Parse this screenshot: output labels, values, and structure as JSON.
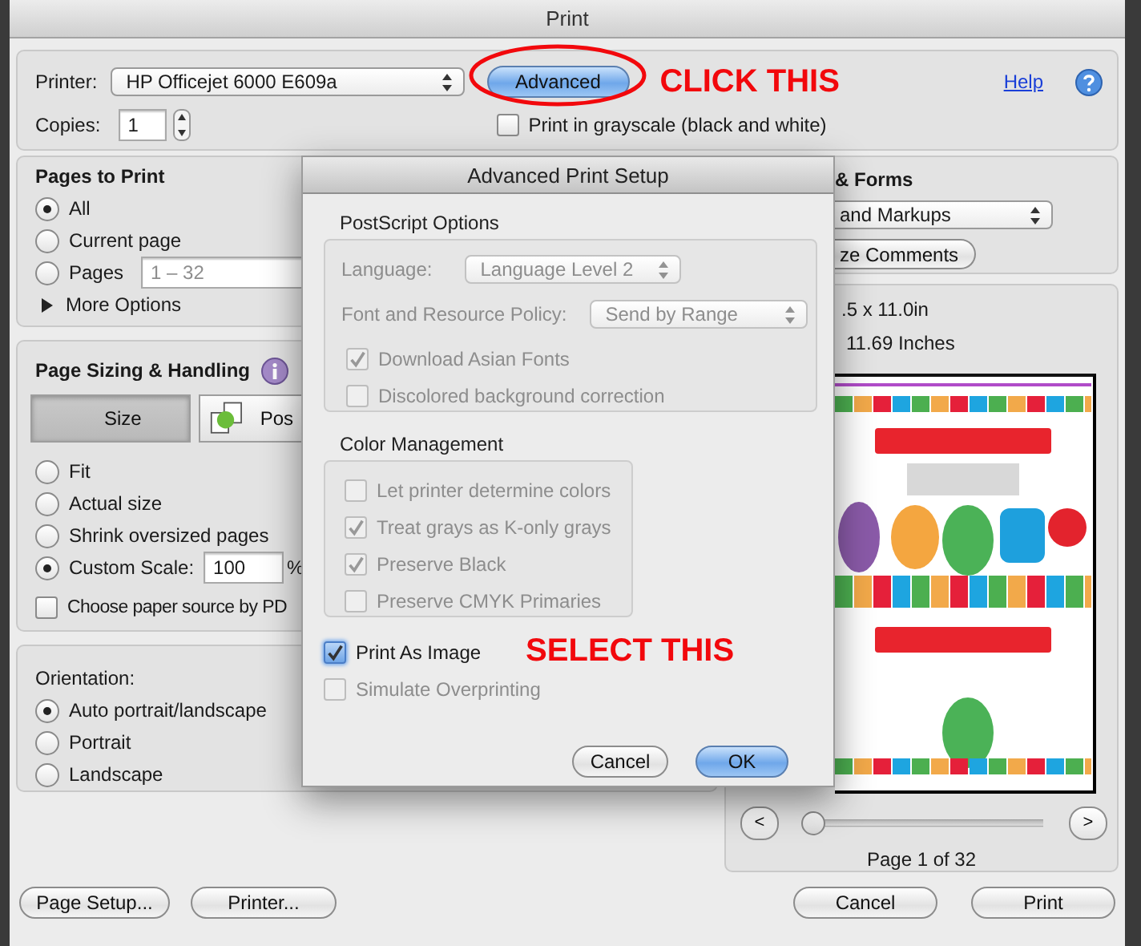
{
  "window": {
    "title": "Print"
  },
  "printer": {
    "label": "Printer:",
    "value": "HP Officejet 6000 E609a"
  },
  "advanced_button": {
    "label": "Advanced"
  },
  "click_note": "CLICK THIS",
  "help_link": "Help",
  "copies": {
    "label": "Copies:",
    "value": "1"
  },
  "grayscale": {
    "label": "Print in grayscale (black and white)",
    "checked": false
  },
  "pages_to_print": {
    "title": "Pages to Print",
    "options": [
      {
        "label": "All",
        "selected": true
      },
      {
        "label": "Current page",
        "selected": false
      },
      {
        "label": "Pages",
        "selected": false
      }
    ],
    "range": {
      "value": "1 – 32",
      "disabled": true
    },
    "more_options": {
      "label": "More Options",
      "expanded": false
    }
  },
  "page_sizing": {
    "title": "Page Sizing & Handling",
    "tabs": [
      {
        "label": "Size",
        "selected": true
      },
      {
        "label": "Pos",
        "selected": false
      }
    ],
    "options": [
      {
        "label": "Fit",
        "selected": false
      },
      {
        "label": "Actual size",
        "selected": false
      },
      {
        "label": "Shrink oversized pages",
        "selected": false
      },
      {
        "label": "Custom Scale:",
        "selected": true
      }
    ],
    "scale": {
      "value": "100",
      "unit": "%"
    },
    "paper_source": {
      "label": "Choose paper source by PD",
      "checked": false
    }
  },
  "orientation": {
    "title": "Orientation:",
    "options": [
      {
        "label": "Auto portrait/landscape",
        "selected": true
      },
      {
        "label": "Portrait",
        "selected": false
      },
      {
        "label": "Landscape",
        "selected": false
      }
    ]
  },
  "comments_forms": {
    "title": "& Forms",
    "dropdown": "and Markups",
    "button": "ze Comments"
  },
  "preview": {
    "paper_size": ".5 x 11.0in",
    "document_size": "11.69 Inches",
    "slider": {
      "level": 0
    },
    "prev": "<",
    "next": ">",
    "page_label": "Page 1 of 32"
  },
  "bottom_buttons_left": [
    "Page Setup...",
    "Printer..."
  ],
  "bottom_buttons_right": [
    "Cancel",
    "Print"
  ],
  "advanced": {
    "title": "Advanced Print Setup",
    "postscript": {
      "title": "PostScript Options",
      "language": {
        "label": "Language:",
        "value": "Language Level 2"
      },
      "policy": {
        "label": "Font and Resource Policy:",
        "value": "Send by Range"
      },
      "checks": [
        {
          "label": "Download Asian Fonts",
          "checked": true,
          "disabled": true
        },
        {
          "label": "Discolored background correction",
          "checked": false,
          "disabled": true
        }
      ]
    },
    "color_management": {
      "title": "Color Management",
      "checks": [
        {
          "label": "Let printer determine colors",
          "checked": false,
          "disabled": true
        },
        {
          "label": "Treat grays as K-only grays",
          "checked": true,
          "disabled": true
        },
        {
          "label": "Preserve Black",
          "checked": true,
          "disabled": true
        },
        {
          "label": "Preserve CMYK Primaries",
          "checked": false,
          "disabled": true
        }
      ]
    },
    "checks": [
      {
        "label": "Print As Image",
        "checked": true,
        "disabled": false
      },
      {
        "label": "Simulate Overprinting",
        "checked": false,
        "disabled": true
      }
    ],
    "select_note": "SELECT THIS",
    "buttons": [
      {
        "label": "Cancel",
        "default": false
      },
      {
        "label": "OK",
        "default": true
      }
    ]
  }
}
